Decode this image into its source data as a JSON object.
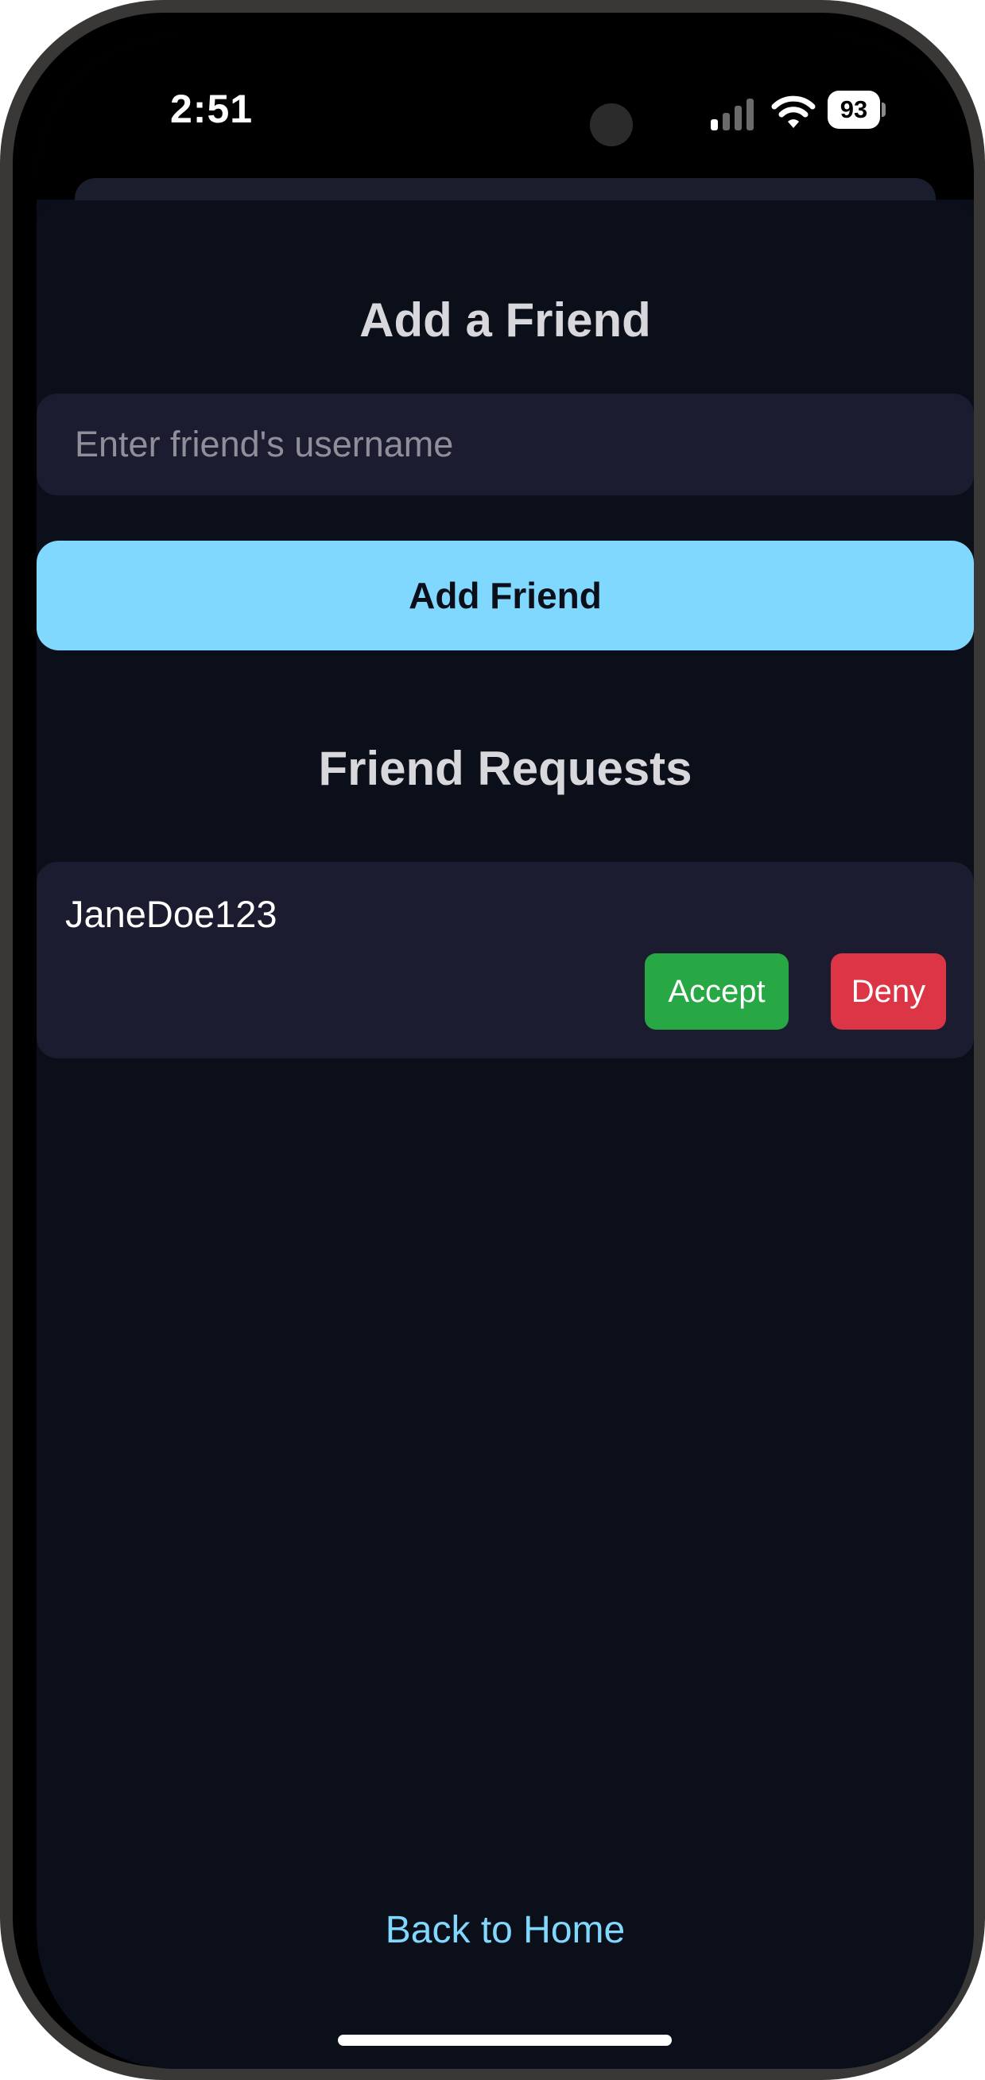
{
  "status_bar": {
    "time": "2:51",
    "battery_level": "93",
    "signal_icon": "cellular-signal-icon",
    "wifi_icon": "wifi-icon",
    "battery_icon": "battery-icon"
  },
  "add_friend": {
    "title": "Add a Friend",
    "input_placeholder": "Enter friend's username",
    "input_value": "",
    "button_label": "Add Friend"
  },
  "friend_requests": {
    "title": "Friend Requests",
    "items": [
      {
        "username": "JaneDoe123",
        "accept_label": "Accept",
        "deny_label": "Deny"
      }
    ]
  },
  "footer": {
    "back_label": "Back to Home"
  },
  "colors": {
    "background": "#0b0f1a",
    "card": "#1b1c2f",
    "accent": "#81d8ff",
    "accept": "#28a745",
    "deny": "#dc3545",
    "heading": "#d8d8dc"
  }
}
